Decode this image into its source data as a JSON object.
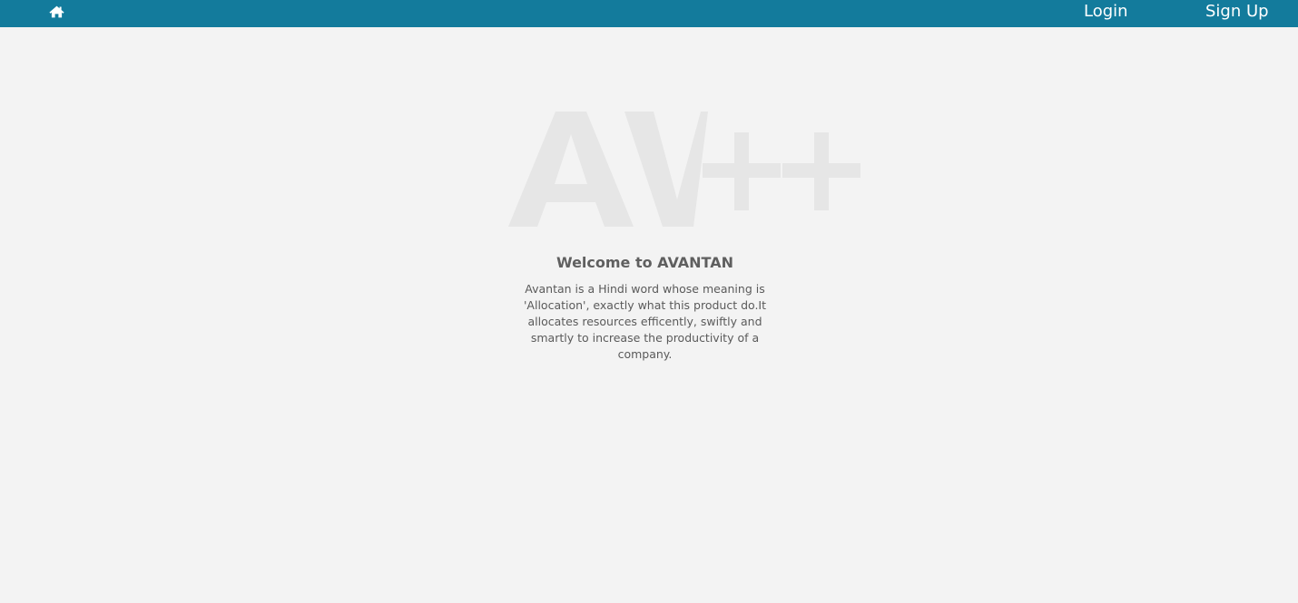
{
  "navbar": {
    "home_icon": "home-icon",
    "login_label": "Login",
    "signup_label": "Sign Up",
    "background_color": "#137b9c"
  },
  "hero": {
    "logo_text": "AV++",
    "logo_color": "#e6e6e6",
    "title": "Welcome to AVANTAN",
    "description": "Avantan is a Hindi word whose meaning is 'Allocation', exactly what this product do.It allocates resources efficently, swiftly and smartly to increase the productivity of a company."
  }
}
